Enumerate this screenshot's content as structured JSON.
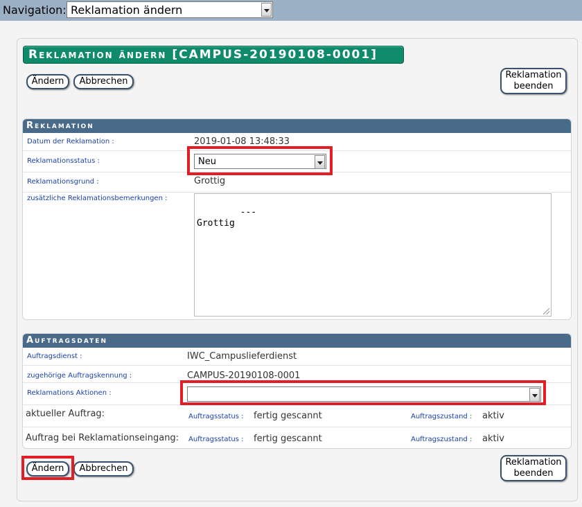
{
  "nav": {
    "label": "Navigation:",
    "selected": "Reklamation ändern"
  },
  "page": {
    "title": "Reklamation ändern [CAMPUS-20190108-0001]"
  },
  "buttons": {
    "change": "Ändern",
    "cancel": "Abbrechen",
    "finish_line1": "Reklamation",
    "finish_line2": "beenden"
  },
  "reklamation": {
    "heading": "Reklamation",
    "date_label": "Datum der Reklamation",
    "date_value": "2019-01-08 13:48:33",
    "status_label": "Reklamationsstatus",
    "status_value": "Neu",
    "reason_label": "Reklamationsgrund",
    "reason_value": "Grottig",
    "remarks_label": "zusätzliche Reklamationsbemerkungen",
    "remarks_value": "---\nGrottig"
  },
  "auftrag": {
    "heading": "Auftragsdaten",
    "service_label": "Auftragsdienst",
    "service_value": "IWC_Campuslieferdienst",
    "id_label": "zugehörige Auftragskennung",
    "id_value": "CAMPUS-20190108-0001",
    "actions_label": "Reklamations Aktionen",
    "actions_value": "",
    "current_label": "aktueller Auftrag:",
    "at_complaint_label": "Auftrag bei Reklamationseingang:",
    "status_sub_label": "Auftragsstatus",
    "status_value": "fertig gescannt",
    "state_sub_label": "Auftragszustand",
    "state_value": "aktiv"
  },
  "colors": {
    "title_bg": "#0f8a6a",
    "section_header_bg": "#4a6a89",
    "navbar_bg": "#9bb0c5",
    "highlight": "#e11d26",
    "label_blue": "#1a3fa8"
  }
}
